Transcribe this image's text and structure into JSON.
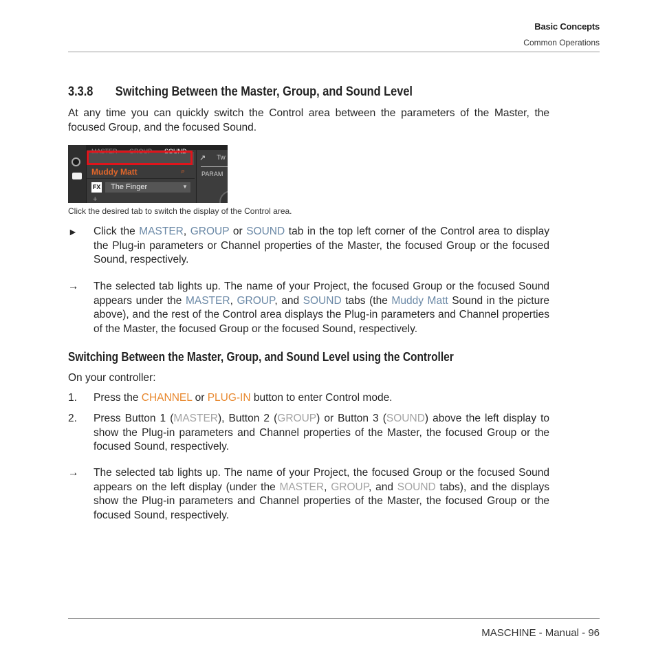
{
  "header": {
    "chapter": "Basic Concepts",
    "section": "Common Operations"
  },
  "section": {
    "number": "3.3.8",
    "title": "Switching Between the Master, Group, and Sound Level",
    "intro": "At any time you can quickly switch the Control area between the parameters of the Master, the focused Group, and the focused Sound."
  },
  "screenshot": {
    "tabs": [
      "MASTER",
      "GROUP",
      "SOUND"
    ],
    "selected_tab": "SOUND",
    "sound_name": "Muddy Matt",
    "fx_label": "FX",
    "plugin_name": "The Finger",
    "right_label_top": "Tw",
    "right_label_param": "PARAM",
    "plus": "+",
    "caption": "Click the desired tab to switch the display of the Control area."
  },
  "software_steps": {
    "instruction": {
      "marker": "►",
      "parts": [
        "Click the ",
        "MASTER",
        ", ",
        "GROUP",
        " or ",
        "SOUND",
        " tab in the top left corner of the Control area to display the Plug-in parameters or Channel properties of the Master, the focused Group or the focused Sound, respectively."
      ]
    },
    "result": {
      "marker": "→",
      "parts": [
        "The selected tab lights up. The name of your Project, the focused Group or the focused Sound appears under the ",
        "MASTER",
        ", ",
        "GROUP",
        ", and ",
        "SOUND",
        " tabs (the ",
        "Muddy Matt",
        " Sound in the picture above), and the rest of the Control area displays the Plug-in parameters and Channel properties of the Master, the focused Group or the focused Sound, respectively."
      ]
    }
  },
  "controller": {
    "heading": "Switching Between the Master, Group, and Sound Level using the Controller",
    "lead": "On your controller:",
    "steps": [
      {
        "marker": "1.",
        "parts": [
          "Press the ",
          "CHANNEL",
          " or ",
          "PLUG-IN",
          " button to enter Control mode."
        ]
      },
      {
        "marker": "2.",
        "parts": [
          "Press Button 1 (",
          "MASTER",
          "), Button 2 (",
          "GROUP",
          ") or Button 3 (",
          "SOUND",
          ") above the left display to show the Plug-in parameters and Channel properties of the Master, the focused Group or the focused Sound, respectively."
        ]
      }
    ],
    "result": {
      "marker": "→",
      "parts": [
        "The selected tab lights up. The name of your Project, the focused Group or the focused Sound appears on the left display (under the ",
        "MASTER",
        ", ",
        "GROUP",
        ", and ",
        "SOUND",
        " tabs), and the displays show the Plug-in parameters and Channel properties of the Master, the focused Group or the focused Sound, respectively."
      ]
    }
  },
  "colors": {
    "software_keyword": "#6a88a6",
    "hardware_keyword": "#e8882e",
    "display_keyword": "#a3a3a3",
    "highlight_box": "#e0141b",
    "sound_name": "#e0662b"
  },
  "footer": {
    "text": "MASCHINE - Manual - 96"
  }
}
